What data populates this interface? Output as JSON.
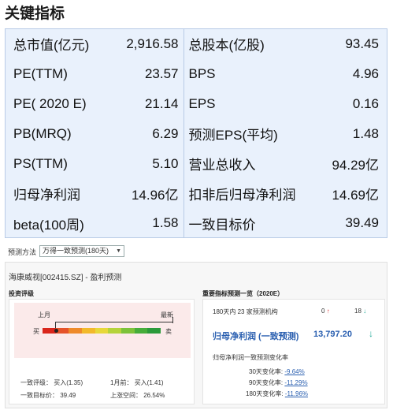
{
  "header": {
    "title": "关键指标"
  },
  "metrics": {
    "rows": [
      {
        "label": "总市值(亿元)",
        "value": "2,916.58",
        "label2": "总股本(亿股)",
        "value2": "93.45"
      },
      {
        "label": "PE(TTM)",
        "value": "23.57",
        "label2": "BPS",
        "value2": "4.96"
      },
      {
        "label": "PE( 2020 E)",
        "value": "21.14",
        "label2": "EPS",
        "value2": "0.16"
      },
      {
        "label": "PB(MRQ)",
        "value": "6.29",
        "label2": "预测EPS(平均)",
        "value2": "1.48"
      },
      {
        "label": "PS(TTM)",
        "value": "5.10",
        "label2": "营业总收入",
        "value2": "94.29亿"
      },
      {
        "label": "归母净利润",
        "value": "14.96亿",
        "label2": "扣非后归母净利润",
        "value2": "14.69亿"
      },
      {
        "label": "beta(100周)",
        "value": "1.58",
        "label2": "一致目标价",
        "value2": "39.49"
      }
    ]
  },
  "toolbar": {
    "method_label": "预测方法",
    "method_value": "万得一致预测(180天)"
  },
  "forecast": {
    "subhead": "海康威视[002415.SZ] - 盈利预测",
    "rating_title": "投资评级",
    "last_month": "上月",
    "latest": "最新",
    "buy": "买",
    "sell": "卖",
    "consensus_rating_label": "一致评级：",
    "consensus_rating_value": "买入(1.35)",
    "month_ago_label": "1月前：",
    "month_ago_value": "买入(1.41)",
    "target_label": "一致目标价：",
    "target_value": "39.49",
    "upside_label": "上涨空间：",
    "upside_value": "26.54%",
    "scale_colors": [
      "#d9261c",
      "#e5532a",
      "#ee8a2a",
      "#f2b92b",
      "#e7d83a",
      "#b5d33b",
      "#7cc23a",
      "#46ad3a",
      "#2b9a3a"
    ]
  },
  "estimates": {
    "title": "重要指标预测一览（2020E）",
    "coverage_text": "180天内 23 家预测机构",
    "up_count": "0",
    "down_count": "18",
    "net_profit_label": "归母净利润 (一致预测)",
    "net_profit_value": "13,797.20",
    "change_title": "归母净利润一致预测变化率",
    "changes": [
      {
        "label": "30天变化率:",
        "value": "-9.64%"
      },
      {
        "label": "90天变化率:",
        "value": "-11.29%"
      },
      {
        "label": "180天变化率:",
        "value": "-11.96%"
      }
    ]
  }
}
